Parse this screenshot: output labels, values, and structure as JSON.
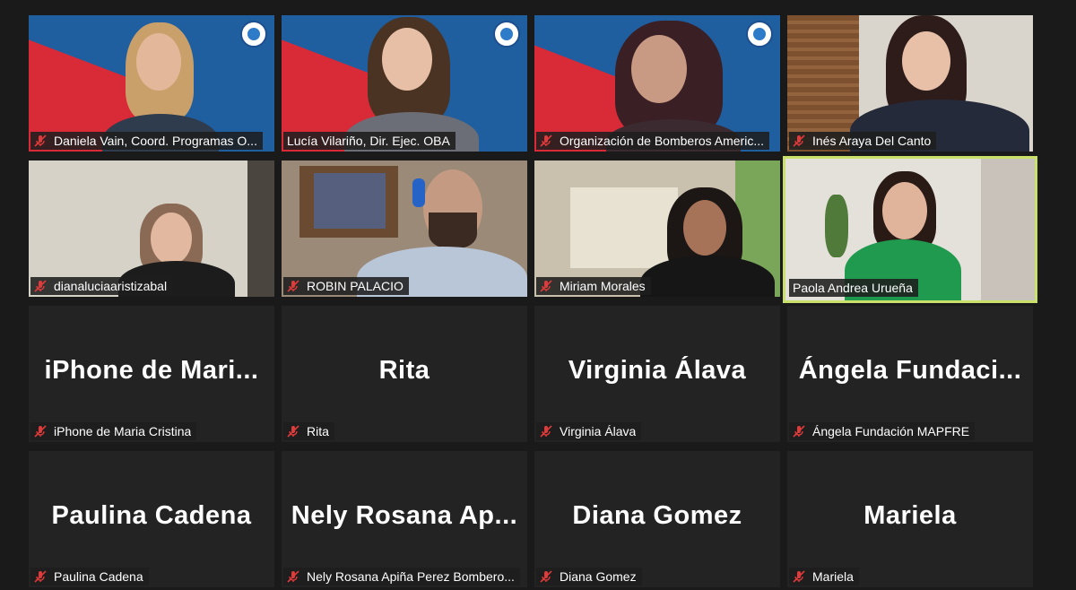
{
  "participants": [
    {
      "display": "Daniela Vain, Coord. Programas O...",
      "big": "",
      "video": true
    },
    {
      "display": "Lucía Vilariño, Dir. Ejec. OBA",
      "big": "",
      "video": true
    },
    {
      "display": "Organización de Bomberos Americ...",
      "big": "",
      "video": true
    },
    {
      "display": "Inés Araya Del Canto",
      "big": "",
      "video": true
    },
    {
      "display": "dianaluciaaristizabal",
      "big": "",
      "video": true
    },
    {
      "display": "ROBIN PALACIO",
      "big": "",
      "video": true
    },
    {
      "display": "Miriam Morales",
      "big": "",
      "video": true
    },
    {
      "display": "Paola  Andrea Urueña",
      "big": "",
      "video": true,
      "active": true
    },
    {
      "display": "iPhone de Maria Cristina",
      "big": "iPhone  de  Mari...",
      "video": false
    },
    {
      "display": "Rita",
      "big": "Rita",
      "video": false
    },
    {
      "display": "Virginia Álava",
      "big": "Virginia  Álava",
      "video": false
    },
    {
      "display": "Ángela Fundación MAPFRE",
      "big": "Ángela  Fundaci...",
      "video": false
    },
    {
      "display": "Paulina Cadena",
      "big": "Paulina  Cadena",
      "video": false
    },
    {
      "display": "Nely Rosana Apiña Perez Bombero...",
      "big": "Nely  Rosana  Ap...",
      "video": false
    },
    {
      "display": "Diana Gomez",
      "big": "Diana  Gomez",
      "video": false
    },
    {
      "display": "Mariela",
      "big": "Mariela",
      "video": false
    }
  ],
  "colors": {
    "mic_muted": "#e03a3a",
    "active_border": "#c9e06a",
    "tile_bg": "#232323",
    "oba_blue": "#1f5fa0",
    "oba_red": "#d92a38"
  },
  "icons": {
    "mic": "mic-muted-icon"
  }
}
